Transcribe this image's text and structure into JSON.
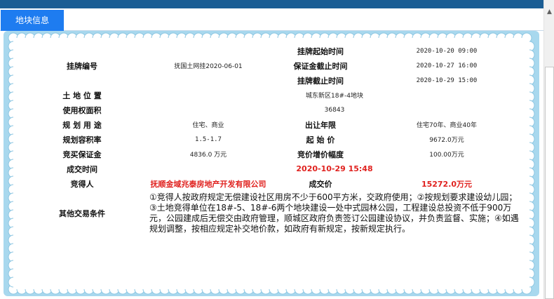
{
  "tab": {
    "label": "地块信息"
  },
  "colors": {
    "topbar": "#1a5d94",
    "tab": "#1e7cf0",
    "frame": "#a8d8ee",
    "highlight": "#e0221f"
  },
  "icons": {
    "scroll_up": "chevron-up-icon"
  },
  "parcel": {
    "listing_no_label": "挂牌编号",
    "listing_no": "抚国土网挂2020-06-01",
    "listing_start_label": "挂牌起始时间",
    "listing_start": "2020-10-20 09:00",
    "deposit_deadline_label": "保证金截止时间",
    "deposit_deadline": "2020-10-27 16:00",
    "listing_end_label": "挂牌截止时间",
    "listing_end": "2020-10-29 15:00",
    "location_label": "土 地 位 置",
    "location": "城东新区18#-4地块",
    "area_label": "使用权面积",
    "area": "36843",
    "use_label": "规 划 用 途",
    "use": "住宅、商业",
    "term_label": "出让年限",
    "term": "住宅70年、商业40年",
    "far_label": "规划容积率",
    "far": "1.5-1.7",
    "start_price_label": "起 始 价",
    "start_price": "9672.0万元",
    "bid_deposit_label": "竞买保证金",
    "bid_deposit": "4836.0 万元",
    "increment_label": "竞价增价幅度",
    "increment": "100.00万元",
    "deal_time_label": "成交时间",
    "deal_time": "2020-10-29 15:48",
    "bidder_label": "竞得人",
    "bidder": "抚顺金域兆泰房地产开发有限公司",
    "deal_price_label": "成交价",
    "deal_price": "15272.0万元",
    "conditions_label": "其他交易条件",
    "conditions": "①竞得人按政府规定无偿建设社区用房不少于600平方米，交政府使用；②按规划要求建设幼儿园；③土地竞得单位在18#-5、18#-6两个地块建设一处中式园林公园，工程建设总投资不低于900万元，公园建成后无偿交由政府管理，顺城区政府负责签订公园建设协议，并负责监督、实施；④如遇规划调整，按相应规定补交地价款，如政府有新规定，按新规定执行。"
  }
}
